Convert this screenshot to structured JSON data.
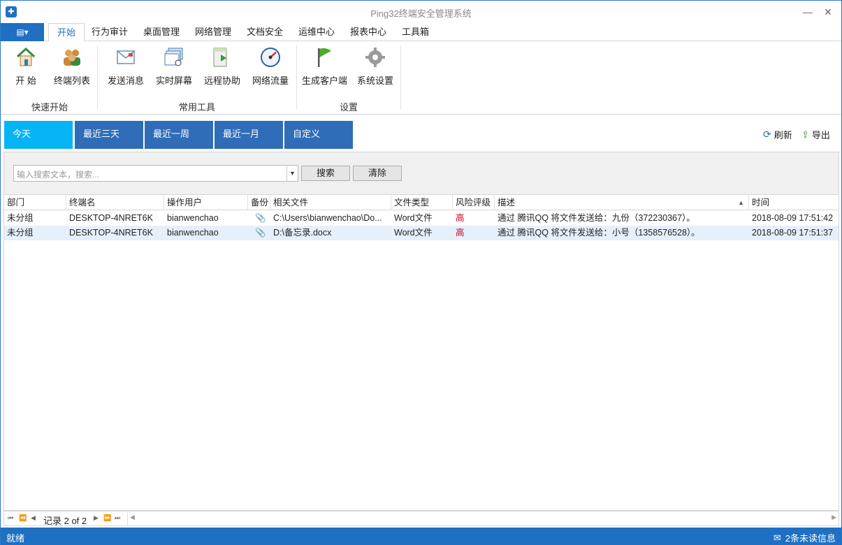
{
  "window": {
    "title": "Ping32终端安全管理系统",
    "app_icon": "shield-icon"
  },
  "menu": {
    "file_label": "▤▾",
    "tabs": [
      "开始",
      "行为审计",
      "桌面管理",
      "网络管理",
      "文档安全",
      "运维中心",
      "报表中心",
      "工具箱"
    ],
    "active_tab": "开始"
  },
  "ribbon": {
    "groups": [
      {
        "label": "快速开始",
        "buttons": [
          {
            "label": "开 始",
            "icon": "home-icon"
          },
          {
            "label": "终端列表",
            "icon": "users-icon"
          }
        ]
      },
      {
        "label": "常用工具",
        "buttons": [
          {
            "label": "发送消息",
            "icon": "message-icon"
          },
          {
            "label": "实时屏幕",
            "icon": "screen-icon"
          },
          {
            "label": "远程协助",
            "icon": "remote-icon"
          },
          {
            "label": "网络流量",
            "icon": "gauge-icon"
          }
        ]
      },
      {
        "label": "设置",
        "buttons": [
          {
            "label": "生成客户端",
            "icon": "flag-icon"
          },
          {
            "label": "系统设置",
            "icon": "gear-icon"
          }
        ]
      }
    ]
  },
  "date_tabs": [
    "今天",
    "最近三天",
    "最近一周",
    "最近一月",
    "自定义"
  ],
  "active_date_tab": "今天",
  "actions": {
    "refresh": "刷新",
    "export": "导出"
  },
  "search": {
    "placeholder": "输入搜索文本，搜索...",
    "search_button": "搜索",
    "clear_button": "清除"
  },
  "table": {
    "columns": [
      "部门",
      "终端名",
      "操作用户",
      "备份",
      "相关文件",
      "文件类型",
      "风险评级",
      "描述",
      "时间"
    ],
    "sort_column": "描述",
    "rows": [
      {
        "dept": "未分组",
        "terminal": "DESKTOP-4NRET6K",
        "user": "bianwenchao",
        "backup": "attachment-icon",
        "file": "C:\\Users\\bianwenchao\\Do...",
        "type": "Word文件",
        "risk": "高",
        "desc": "通过 腾讯QQ 将文件发送给：九份（372230367）。",
        "time": "2018-08-09 17:51:42"
      },
      {
        "dept": "未分组",
        "terminal": "DESKTOP-4NRET6K",
        "user": "bianwenchao",
        "backup": "attachment-icon",
        "file": "D:\\备忘录.docx",
        "type": "Word文件",
        "risk": "高",
        "desc": "通过 腾讯QQ 将文件发送给：小号（1358576528）。",
        "time": "2018-08-09 17:51:37"
      }
    ]
  },
  "navigator": {
    "text": "记录 2 of 2"
  },
  "status": {
    "left": "就绪",
    "right": "2条未读信息"
  },
  "colors": {
    "accent": "#1f6fc2",
    "active_tab": "#06b4f5",
    "tab": "#2f6db8",
    "risk_high": "#d0021b",
    "selected_row": "#e5f0fb"
  }
}
